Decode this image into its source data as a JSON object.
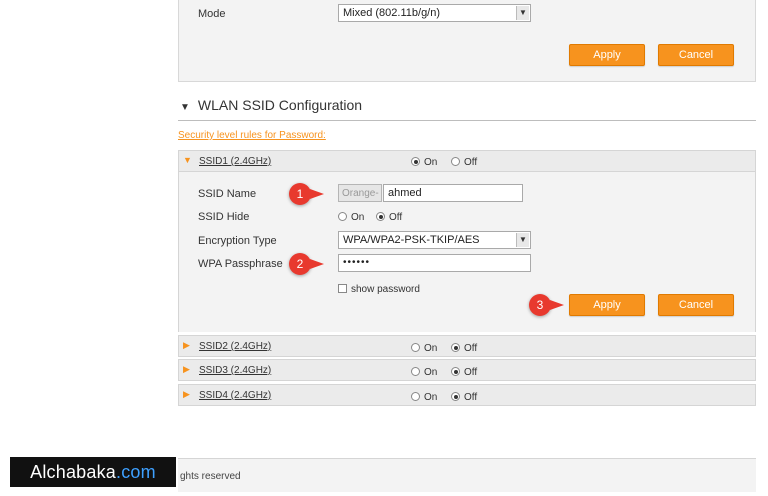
{
  "wireless": {
    "mode_label": "Mode",
    "mode_value": "Mixed (802.11b/g/n)",
    "apply_label": "Apply",
    "cancel_label": "Cancel"
  },
  "ssid_section": {
    "title": "WLAN SSID Configuration",
    "security_link": "Security level rules for Password:",
    "on_label": "On",
    "off_label": "Off",
    "ssids": [
      {
        "name": "SSID1 (2.4GHz)",
        "state": "on"
      },
      {
        "name": "SSID2 (2.4GHz)",
        "state": "off"
      },
      {
        "name": "SSID3 (2.4GHz)",
        "state": "off"
      },
      {
        "name": "SSID4 (2.4GHz)",
        "state": "off"
      }
    ],
    "ssid1": {
      "ssid_name_label": "SSID Name",
      "ssid_prefix": "Orange-",
      "ssid_name_value": "ahmed",
      "ssid_hide_label": "SSID Hide",
      "ssid_hide_value": "off",
      "encryption_label": "Encryption Type",
      "encryption_value": "WPA/WPA2-PSK-TKIP/AES",
      "passphrase_label": "WPA Passphrase",
      "passphrase_value": "••••••",
      "show_password_label": "show password",
      "apply_label": "Apply",
      "cancel_label": "Cancel"
    }
  },
  "annotations": [
    "1",
    "2",
    "3"
  ],
  "footer": {
    "text": "ghts reserved"
  },
  "watermark": {
    "brand": "Alchabaka",
    "tld": ".com"
  },
  "colors": {
    "accent": "#f7931e",
    "badge": "#e8392e"
  }
}
